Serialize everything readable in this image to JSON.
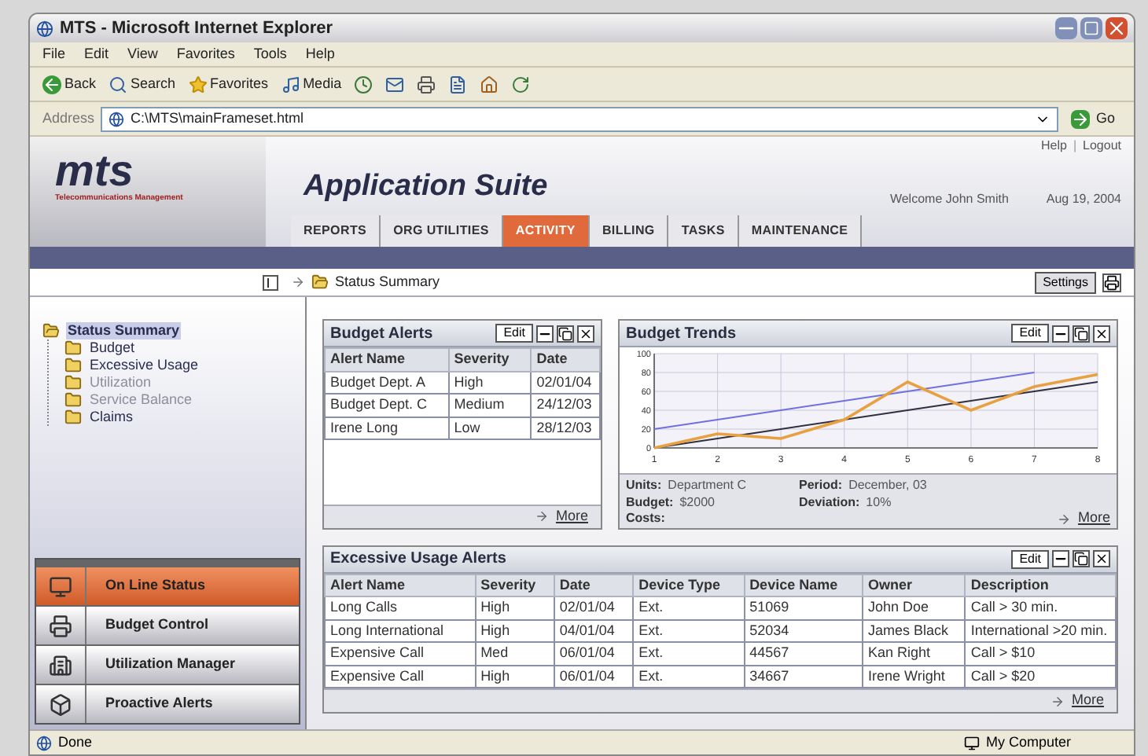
{
  "window": {
    "title": "MTS - Microsoft Internet Explorer"
  },
  "menu": [
    "File",
    "Edit",
    "View",
    "Favorites",
    "Tools",
    "Help"
  ],
  "toolbar": [
    {
      "kind": "back",
      "label": "Back"
    },
    {
      "kind": "search",
      "label": "Search"
    },
    {
      "kind": "favorites",
      "label": "Favorites"
    },
    {
      "kind": "media",
      "label": "Media"
    }
  ],
  "address": {
    "label": "Address",
    "value": "C:\\MTS\\mainFrameset.html",
    "go": "Go"
  },
  "header": {
    "logo": "mts",
    "logo_subtitle": "Telecommunications Management",
    "title": "Application Suite",
    "links": [
      "Help",
      "Logout"
    ],
    "separator": "|",
    "welcome": "Welcome John Smith",
    "date": "Aug 19, 2004"
  },
  "nav_tabs": [
    {
      "label": "REPORTS",
      "selected": false
    },
    {
      "label": "ORG UTILITIES",
      "selected": false
    },
    {
      "label": "ACTIVITY",
      "selected": true
    },
    {
      "label": "BILLING",
      "selected": false
    },
    {
      "label": "TASKS",
      "selected": false
    },
    {
      "label": "MAINTENANCE",
      "selected": false
    }
  ],
  "breadcrumb": {
    "current": "Status Summary",
    "settings": "Settings"
  },
  "tree": [
    {
      "label": "Status Summary",
      "selected": true,
      "disabled": false,
      "children": [
        {
          "label": "Budget",
          "selected": false,
          "disabled": false
        },
        {
          "label": "Excessive Usage",
          "selected": false,
          "disabled": false
        },
        {
          "label": "Utilization",
          "selected": false,
          "disabled": true
        },
        {
          "label": "Service Balance",
          "selected": false,
          "disabled": true
        },
        {
          "label": "Claims",
          "selected": false,
          "disabled": false
        }
      ]
    }
  ],
  "side_panel": [
    {
      "label": "On Line Status",
      "selected": true
    },
    {
      "label": "Budget Control",
      "selected": false
    },
    {
      "label": "Utilization Manager",
      "selected": false
    },
    {
      "label": "Proactive Alerts",
      "selected": false
    }
  ],
  "budget_alerts": {
    "title": "Budget Alerts",
    "edit": "Edit",
    "columns": [
      "Alert Name",
      "Severity",
      "Date"
    ],
    "rows": [
      [
        "Budget Dept. A",
        "High",
        "02/01/04"
      ],
      [
        "Budget Dept. C",
        "Medium",
        "24/12/03"
      ],
      [
        "Irene Long",
        "Low",
        "28/12/03"
      ]
    ],
    "more": "More"
  },
  "budget_trends": {
    "title": "Budget Trends",
    "edit": "Edit",
    "chart_data": {
      "type": "line",
      "x": [
        1,
        2,
        3,
        4,
        5,
        6,
        7,
        8
      ],
      "xlim": [
        1,
        8
      ],
      "ylim": [
        0,
        100
      ],
      "grid": true,
      "yticks": [
        0,
        20,
        40,
        60,
        80,
        100
      ],
      "xticks": [
        1,
        2,
        3,
        4,
        5,
        6,
        7,
        8
      ],
      "series": [
        {
          "color": "#7070e0",
          "values": [
            20,
            30,
            40,
            50,
            60,
            70,
            80,
            null
          ]
        },
        {
          "color": "#303040",
          "values": [
            0,
            10,
            20,
            30,
            40,
            50,
            60,
            70
          ]
        },
        {
          "color": "#e8a040",
          "values": [
            0,
            15,
            10,
            30,
            70,
            40,
            65,
            78
          ]
        }
      ]
    },
    "details": [
      {
        "label": "Units:",
        "value": "Department C"
      },
      {
        "label": "Period:",
        "value": "December, 03"
      },
      {
        "label": "Budget:",
        "value": "$2000"
      },
      {
        "label": "Deviation:",
        "value": "10%"
      },
      {
        "label": "Costs:"
      }
    ],
    "more": "More"
  },
  "excessive_usage": {
    "title": "Excessive Usage Alerts",
    "edit": "Edit",
    "columns": [
      "Alert Name",
      "Severity",
      "Date",
      "Device Type",
      "Device Name",
      "Owner",
      "Description"
    ],
    "rows": [
      [
        "Long Calls",
        "High",
        "02/01/04",
        "Ext.",
        "51069",
        "John Doe",
        "Call > 30 min."
      ],
      [
        "Long International",
        "High",
        "04/01/04",
        "Ext.",
        "52034",
        "James Black",
        "International >20 min."
      ],
      [
        "Expensive Call",
        "Med",
        "06/01/04",
        "Ext.",
        "44567",
        "Kan Right",
        "Call > $10"
      ],
      [
        "Expensive Call",
        "High",
        "06/01/04",
        "Ext.",
        "34667",
        "Irene Wright",
        "Call > $20"
      ]
    ],
    "more": "More"
  },
  "status_bar": {
    "text": "Done",
    "zone": "My Computer"
  }
}
